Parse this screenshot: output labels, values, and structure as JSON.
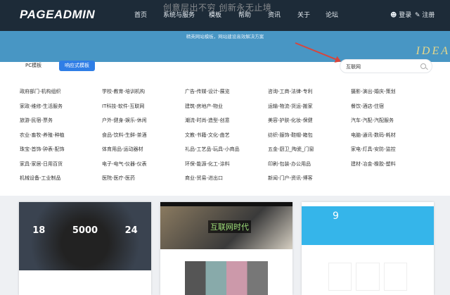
{
  "header": {
    "logo": "PAGEADMIN",
    "slogan": "创意层出不穷 创新永无止境",
    "nav": [
      "首页",
      "系统与服务",
      "模板",
      "帮助",
      "资讯",
      "关于",
      "论坛"
    ],
    "login": "登录",
    "register": "注册"
  },
  "banner": {
    "subtitle": "精英网站模板，网站建设高效解决方案",
    "art_text": "IDEA"
  },
  "tabs": [
    {
      "label": "PC模板",
      "active": false
    },
    {
      "label": "响应式模板",
      "active": true
    }
  ],
  "search": {
    "value": "互联网"
  },
  "accent": "#2f7ee6",
  "categories": [
    [
      "政府部门-机构组织",
      "学校-教育-培训机构",
      "广告-传媒-设计-展览",
      "咨询-工商-法律-专利",
      "摄影-演出-婚庆-策划"
    ],
    [
      "家政-维修-生活服务",
      "IT科技-软件-互联网",
      "建筑-房地产-物业",
      "运输-物流-货运-搬家",
      "餐饮-酒店-住宿"
    ],
    [
      "旅游-民宿-票务",
      "户外-健身-娱乐-休闲",
      "潮流-时尚-造型-创意",
      "美容-护肤-化妆-保健",
      "汽车-汽配-汽配服务"
    ],
    [
      "农业-畜牧-养殖-种植",
      "食品-饮料-生鲜-茶酒",
      "文教-书籍-文化-曲艺",
      "纺织-服饰-鞋帽-箱包",
      "电脑-通讯-数码-耗材"
    ],
    [
      "珠宝-首饰-钟表-配饰",
      "体育用品-运动器材",
      "礼品-工艺品-玩具-小商品",
      "五金-厨卫_陶瓷_门窗",
      "家电-灯具-安防-监控"
    ],
    [
      "家具-家居-日用百货",
      "电子-电气-仪器-仪表",
      "环保-能源-化工-涂料",
      "印刷-包装-办公用品",
      "建材-冶金-橡胶-塑料"
    ],
    [
      "机械设备-工业制品",
      "医院-医疗-医药",
      "商业-贸易-进出口",
      "新闻-门户-资讯-博客",
      ""
    ]
  ],
  "cards": [
    {
      "stats": [
        "18",
        "5000",
        "24"
      ]
    },
    {
      "headline": "互联网时代"
    },
    {
      "number": "9"
    }
  ]
}
